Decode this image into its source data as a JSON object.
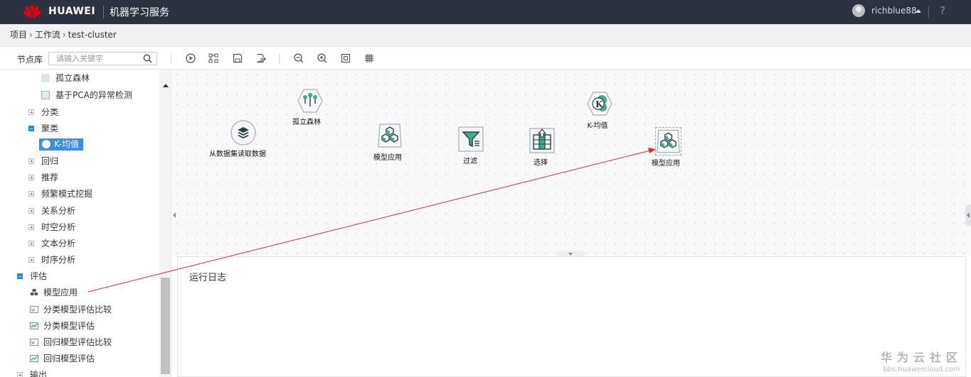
{
  "topbar": {
    "brand": "HUAWEI",
    "service": "机器学习服务",
    "username": "richblue88",
    "help": "?"
  },
  "breadcrumb": [
    "项目",
    "工作流",
    "test-cluster"
  ],
  "toolbar": {
    "library_label": "节点库",
    "search_placeholder": "请输入关键字"
  },
  "sidebar": {
    "items": [
      {
        "label": "孤立森林",
        "type": "leaf"
      },
      {
        "label": "基于PCA的异常检测",
        "type": "leaf"
      },
      {
        "label": "分类",
        "type": "collapsed"
      },
      {
        "label": "聚类",
        "type": "expanded"
      },
      {
        "label": "K-均值",
        "type": "selected"
      },
      {
        "label": "回归",
        "type": "collapsed"
      },
      {
        "label": "推荐",
        "type": "collapsed"
      },
      {
        "label": "频繁模式挖掘",
        "type": "collapsed"
      },
      {
        "label": "关系分析",
        "type": "collapsed"
      },
      {
        "label": "时空分析",
        "type": "collapsed"
      },
      {
        "label": "文本分析",
        "type": "collapsed"
      },
      {
        "label": "时序分析",
        "type": "collapsed"
      },
      {
        "label": "评估",
        "type": "expanded"
      },
      {
        "label": "模型应用",
        "type": "leaf"
      },
      {
        "label": "分类模型评估比较",
        "type": "leaf"
      },
      {
        "label": "分类模型评估",
        "type": "leaf"
      },
      {
        "label": "回归模型评估比较",
        "type": "leaf"
      },
      {
        "label": "回归模型评估",
        "type": "leaf"
      },
      {
        "label": "输出",
        "type": "collapsed"
      }
    ]
  },
  "canvas": {
    "nodes": [
      {
        "label": "从数据集读取数据",
        "icon": "layers-icon"
      },
      {
        "label": "孤立森林",
        "icon": "tree-icon"
      },
      {
        "label": "模型应用",
        "icon": "cubes-icon"
      },
      {
        "label": "过滤",
        "icon": "filter-icon"
      },
      {
        "label": "选择",
        "icon": "select-icon"
      },
      {
        "label": "K-均值",
        "icon": "kmeans-icon"
      },
      {
        "label": "模型应用",
        "icon": "cubes-icon"
      }
    ]
  },
  "log": {
    "title": "运行日志"
  },
  "watermark": {
    "title": "华为云社区",
    "url": "bbs.huaweicloud.com"
  },
  "colors": {
    "topbar": "#2c3240",
    "accent": "#3a8ee6",
    "arrow": "#d32f2f"
  }
}
